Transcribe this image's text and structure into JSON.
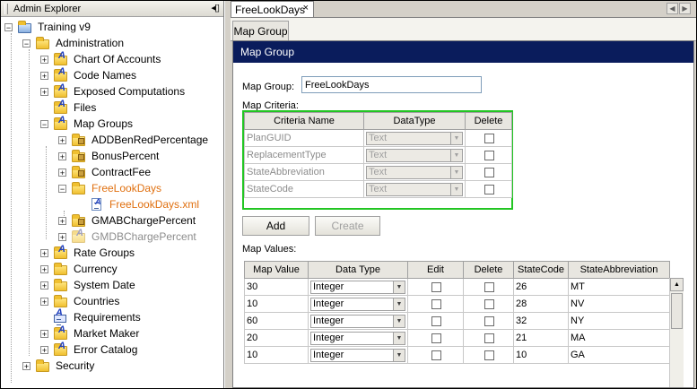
{
  "explorer": {
    "title": "Admin Explorer",
    "pin_glyph": "◂▯",
    "tree": [
      {
        "label": "Training v9",
        "style": "normal"
      },
      {
        "label": "Administration",
        "style": "normal"
      },
      {
        "label": "Chart Of Accounts",
        "style": "normal"
      },
      {
        "label": "Code Names",
        "style": "normal"
      },
      {
        "label": "Exposed Computations",
        "style": "normal"
      },
      {
        "label": "Files",
        "style": "normal"
      },
      {
        "label": "Map Groups",
        "style": "normal"
      },
      {
        "label": "ADDBenRedPercentage",
        "style": "normal"
      },
      {
        "label": "BonusPercent",
        "style": "normal"
      },
      {
        "label": "ContractFee",
        "style": "normal"
      },
      {
        "label": "FreeLookDays",
        "style": "orange"
      },
      {
        "label": "FreeLookDays.xml",
        "style": "orange"
      },
      {
        "label": "GMABChargePercent",
        "style": "normal"
      },
      {
        "label": "GMDBChargePercent",
        "style": "gray"
      },
      {
        "label": "Rate Groups",
        "style": "normal"
      },
      {
        "label": "Currency",
        "style": "normal"
      },
      {
        "label": "System Date",
        "style": "normal"
      },
      {
        "label": "Countries",
        "style": "normal"
      },
      {
        "label": "Requirements",
        "style": "normal"
      },
      {
        "label": "Market Maker",
        "style": "normal"
      },
      {
        "label": "Error Catalog",
        "style": "normal"
      },
      {
        "label": "Security",
        "style": "normal"
      }
    ]
  },
  "doc_tab": {
    "label": "FreeLookDays",
    "close": "×"
  },
  "sub_tab": {
    "label": "Map Group"
  },
  "banner": "Map Group",
  "form": {
    "map_group_label": "Map Group:",
    "map_group_value": "FreeLookDays",
    "map_criteria_label": "Map Criteria:",
    "map_values_label": "Map Values:"
  },
  "criteria": {
    "headers": [
      "Criteria Name",
      "DataType",
      "Delete"
    ],
    "rows": [
      {
        "name": "PlanGUID",
        "type": "Text"
      },
      {
        "name": "ReplacementType",
        "type": "Text"
      },
      {
        "name": "StateAbbreviation",
        "type": "Text"
      },
      {
        "name": "StateCode",
        "type": "Text"
      }
    ]
  },
  "buttons": {
    "add": "Add",
    "create": "Create"
  },
  "values": {
    "headers": [
      "Map Value",
      "Data Type",
      "Edit",
      "Delete",
      "StateCode",
      "StateAbbreviation"
    ],
    "rows": [
      {
        "value": "30",
        "type": "Integer",
        "code": "26",
        "abbr": "MT"
      },
      {
        "value": "10",
        "type": "Integer",
        "code": "28",
        "abbr": "NV"
      },
      {
        "value": "60",
        "type": "Integer",
        "code": "32",
        "abbr": "NY"
      },
      {
        "value": "20",
        "type": "Integer",
        "code": "21",
        "abbr": "MA"
      },
      {
        "value": "10",
        "type": "Integer",
        "code": "10",
        "abbr": "GA"
      }
    ]
  },
  "colors": {
    "banner": "#0a1c5c",
    "selected_node": "#e07010",
    "criteria_border": "#22c522"
  }
}
